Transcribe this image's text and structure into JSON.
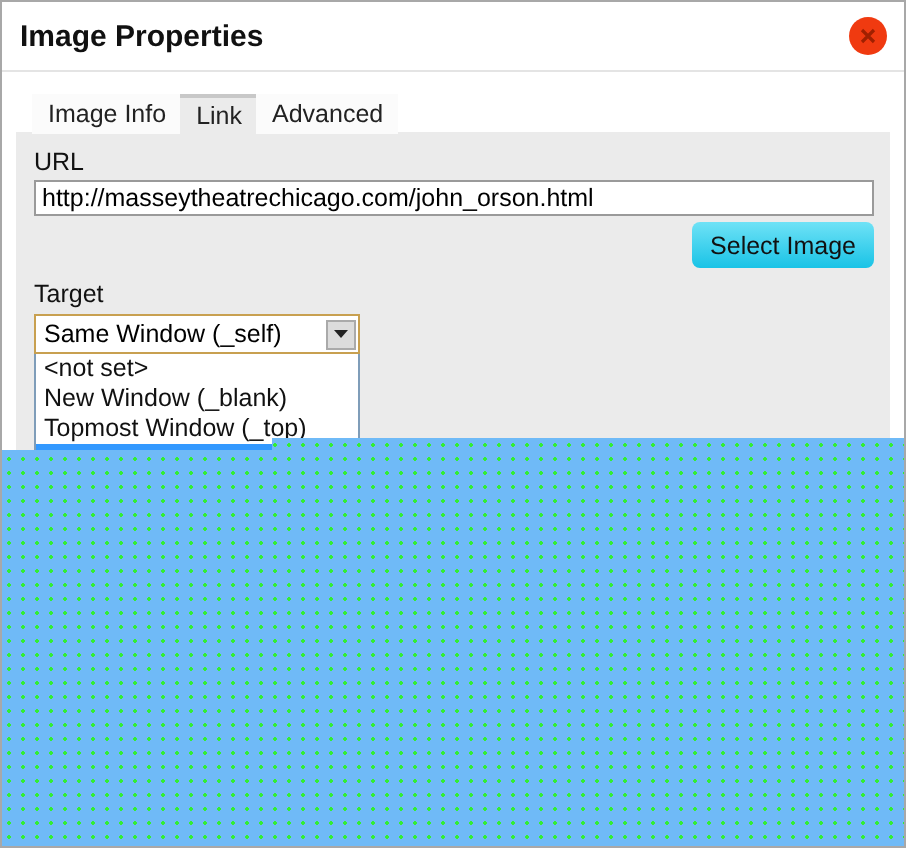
{
  "window": {
    "title": "Image Properties"
  },
  "tabs": [
    {
      "label": "Image Info",
      "selected": false
    },
    {
      "label": "Link",
      "selected": true
    },
    {
      "label": "Advanced",
      "selected": false
    }
  ],
  "url": {
    "label": "URL",
    "value": "http://masseytheatrechicago.com/john_orson.html"
  },
  "select_image_button": "Select Image",
  "target": {
    "label": "Target",
    "value": "Same Window (_self)",
    "expanded": true,
    "options": [
      {
        "label": "<not set>",
        "selected": false
      },
      {
        "label": "New Window (_blank)",
        "selected": false
      },
      {
        "label": "Topmost Window (_top)",
        "selected": false
      },
      {
        "selected": true
      }
    ]
  }
}
